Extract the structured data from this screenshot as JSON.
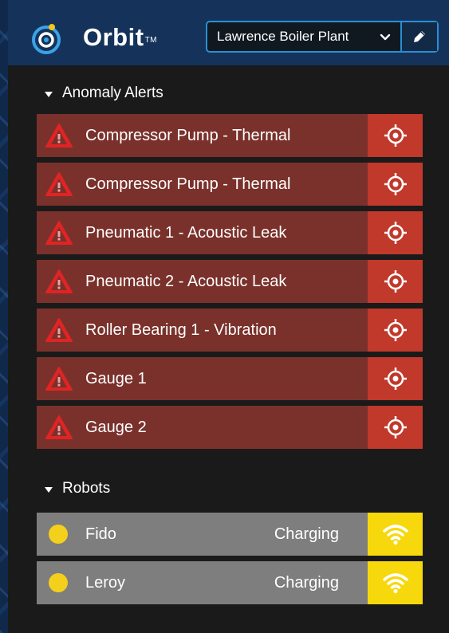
{
  "app": {
    "brand": "Orbit",
    "trademark": "TM"
  },
  "site_selector": {
    "selected": "Lawrence Boiler Plant"
  },
  "alerts_section": {
    "title": "Anomaly Alerts",
    "items": [
      {
        "label": "Compressor Pump - Thermal"
      },
      {
        "label": "Compressor Pump - Thermal"
      },
      {
        "label": "Pneumatic 1 - Acoustic Leak"
      },
      {
        "label": "Pneumatic 2 - Acoustic Leak"
      },
      {
        "label": "Roller Bearing 1 - Vibration"
      },
      {
        "label": "Gauge 1"
      },
      {
        "label": "Gauge 2"
      }
    ]
  },
  "robots_section": {
    "title": "Robots",
    "items": [
      {
        "name": "Fido",
        "status": "Charging"
      },
      {
        "name": "Leroy",
        "status": "Charging"
      }
    ]
  },
  "colors": {
    "alert_row": "#7a312b",
    "alert_action": "#c0392b",
    "robot_row": "#7e7e7e",
    "robot_signal": "#f6d80c",
    "robot_dot": "#f3d01b",
    "accent": "#2a8fd6"
  },
  "icons": {
    "logo": "orbit-logo",
    "alert": "warning-icon",
    "locate": "crosshair-icon",
    "signal": "wifi-icon",
    "dropdown": "chevron-down-icon",
    "edit": "pencil-icon"
  }
}
